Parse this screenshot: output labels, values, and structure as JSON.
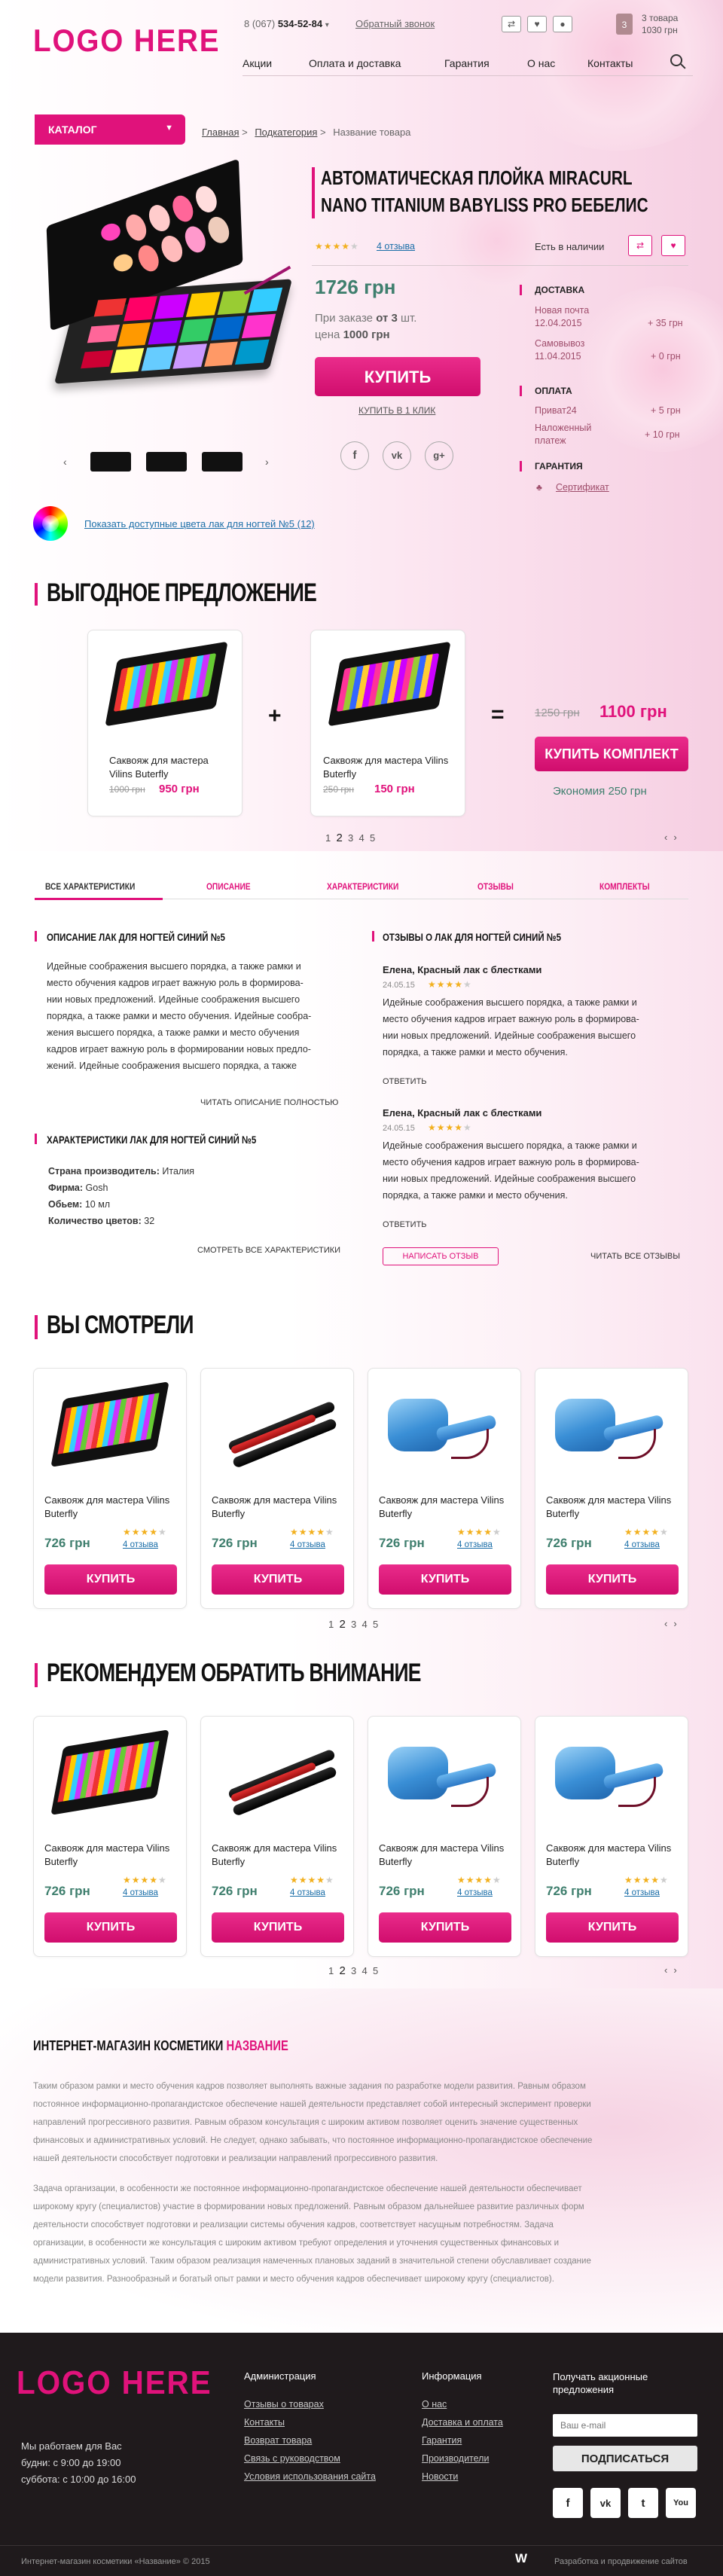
{
  "header": {
    "logo": "LOGO HERE",
    "phone_prefix": "8 (067)",
    "phone_number": "534-52-84",
    "callback": "Обратный звонок",
    "cart_count": "3",
    "cart_items": "3 товара",
    "cart_total": "1030 грн",
    "nav": [
      "Акции",
      "Оплата и доставка",
      "Гарантия",
      "О нас",
      "Контакты"
    ]
  },
  "catalog_label": "КАТАЛОГ",
  "breadcrumbs": [
    "Главная",
    "Подкатегория",
    "Название товара"
  ],
  "product": {
    "title_line1": "АВТОМАТИЧЕСКАЯ ПЛОЙКА MIRACURL",
    "title_line2": "NANO TITANIUM BABYLISS PRO БЕБЕЛИС",
    "rating": 4,
    "reviews_link": "4 отзыва",
    "stock": "Есть в наличии",
    "price": "1726 грн",
    "bulk_line1_a": "При заказе",
    "bulk_line1_b": "от 3",
    "bulk_line1_c": "шт.",
    "bulk_line2_a": "цена",
    "bulk_line2_b": "1000 грн",
    "buy": "КУПИТЬ",
    "one_click": "КУПИТЬ В 1 КЛИК",
    "colors_link": "Показать доступные цвета лак для ногтей №5 (12)"
  },
  "delivery": {
    "title": "ДОСТАВКА",
    "rows": [
      {
        "name": "Новая почта",
        "date": "12.04.2015",
        "price": "+ 35 грн"
      },
      {
        "name": "Самовывоз",
        "date": "11.04.2015",
        "price": "+ 0 грн"
      }
    ]
  },
  "payment": {
    "title": "ОПЛАТА",
    "rows": [
      {
        "name": "Приват24",
        "price": "+ 5 грн"
      },
      {
        "name": "Наложенный платеж",
        "price": "+ 10 грн"
      }
    ]
  },
  "guarantee": {
    "title": "ГАРАНТИЯ",
    "link": "Сертификат"
  },
  "bundle": {
    "title": "ВЫГОДНОЕ ПРЕДЛОЖЕНИЕ",
    "items": [
      {
        "name": "Саквояж для мастера Vilins Buterfly",
        "old": "1000 грн",
        "price": "950 грн"
      },
      {
        "name": "Саквояж для мастера Vilins Buterfly",
        "old": "250 грн",
        "price": "150 грн"
      }
    ],
    "plus": "+",
    "equals": "=",
    "old_total": "1250 грн",
    "total": "1100 грн",
    "buy": "КУПИТЬ КОМПЛЕКТ",
    "saving": "Экономия 250 грн",
    "pages": [
      "1",
      "2",
      "3",
      "4",
      "5"
    ]
  },
  "tabs": [
    "ВСЕ ХАРАКТЕРИСТИКИ",
    "ОПИСАНИЕ",
    "ХАРАКТЕРИСТИКИ",
    "ОТЗЫВЫ",
    "КОМПЛЕКТЫ"
  ],
  "description": {
    "title": "ОПИСАНИЕ ЛАК ДЛЯ НОГТЕЙ СИНИЙ №5",
    "lines": [
      "Идейные соображения высшего порядка, а также рамки и",
      "место обучения кадров играет важную роль в формирова-",
      "нии новых предложений. Идейные соображения высшего",
      "порядка, а также рамки и место обучения. Идейные сообра-",
      "жения высшего порядка, а также рамки и место обучения",
      "кадров играет важную роль в формировании новых предло-",
      "жений. Идейные соображения высшего порядка, а также"
    ],
    "more": "ЧИТАТЬ ОПИСАНИЕ ПОЛНОСТЬЮ"
  },
  "specs": {
    "title": "ХАРАКТЕРИСТИКИ ЛАК ДЛЯ НОГТЕЙ СИНИЙ №5",
    "rows": [
      {
        "k": "Страна производитель:",
        "v": "Италия"
      },
      {
        "k": "Фирма:",
        "v": "Gosh"
      },
      {
        "k": "Обьем:",
        "v": "10 мл"
      },
      {
        "k": "Количество цветов:",
        "v": "32"
      }
    ],
    "more": "СМОТРЕТЬ ВСЕ ХАРАКТЕРИСТИКИ"
  },
  "reviews": {
    "title": "ОТЗЫВЫ О ЛАК ДЛЯ НОГТЕЙ СИНИЙ №5",
    "items": [
      {
        "author": "Елена, Красный лак с блестками",
        "date": "24.05.15",
        "rating": 4,
        "lines": [
          "Идейные соображения высшего порядка, а также рамки и",
          "место обучения кадров играет важную роль в формирова-",
          "нии новых предложений. Идейные соображения высшего",
          "порядка, а также рамки и место обучения."
        ],
        "reply": "ОТВЕТИТЬ"
      },
      {
        "author": "Елена, Красный лак с блестками",
        "date": "24.05.15",
        "rating": 4,
        "lines": [
          "Идейные соображения высшего порядка, а также рамки и",
          "место обучения кадров играет важную роль в формирова-",
          "нии новых предложений. Идейные соображения высшего",
          "порядка, а также рамки и место обучения."
        ],
        "reply": "ОТВЕТИТЬ"
      }
    ],
    "write": "НАПИСАТЬ ОТЗЫВ",
    "read_all": "ЧИТАТЬ ВСЕ ОТЗЫВЫ"
  },
  "viewed": {
    "title": "ВЫ СМОТРЕЛИ",
    "products": [
      {
        "name": "Саквояж для мастера Vilins Buterfly",
        "price": "726 грн",
        "reviews": "4 отзыва",
        "rating": 4,
        "buy": "КУПИТЬ",
        "image": "palette"
      },
      {
        "name": "Саквояж для мастера Vilins Buterfly",
        "price": "726 грн",
        "reviews": "4 отзыва",
        "rating": 4,
        "buy": "КУПИТЬ",
        "image": "straightener"
      },
      {
        "name": "Саквояж для мастера Vilins Buterfly",
        "price": "726 грн",
        "reviews": "4 отзыва",
        "rating": 4,
        "buy": "КУПИТЬ",
        "image": "curler"
      },
      {
        "name": "Саквояж для мастера Vilins Buterfly",
        "price": "726 грн",
        "reviews": "4 отзыва",
        "rating": 4,
        "buy": "КУПИТЬ",
        "image": "curler"
      }
    ],
    "pages": [
      "1",
      "2",
      "3",
      "4",
      "5"
    ]
  },
  "recommended": {
    "title": "РЕКОМЕНДУЕМ ОБРАТИТЬ ВНИМАНИЕ",
    "products": [
      {
        "name": "Саквояж для мастера Vilins Buterfly",
        "price": "726 грн",
        "reviews": "4 отзыва",
        "rating": 4,
        "buy": "КУПИТЬ",
        "image": "palette"
      },
      {
        "name": "Саквояж для мастера Vilins Buterfly",
        "price": "726 грн",
        "reviews": "4 отзыва",
        "rating": 4,
        "buy": "КУПИТЬ",
        "image": "straightener"
      },
      {
        "name": "Саквояж для мастера Vilins Buterfly",
        "price": "726 грн",
        "reviews": "4 отзыва",
        "rating": 4,
        "buy": "КУПИТЬ",
        "image": "curler"
      },
      {
        "name": "Саквояж для мастера Vilins Buterfly",
        "price": "726 грн",
        "reviews": "4 отзыва",
        "rating": 4,
        "buy": "КУПИТЬ",
        "image": "curler"
      }
    ],
    "pages": [
      "1",
      "2",
      "3",
      "4",
      "5"
    ]
  },
  "seo": {
    "title_a": "ИНТЕРНЕТ-МАГАЗИН КОСМЕТИКИ",
    "title_b": "НАЗВАНИЕ",
    "p1": [
      "Таким образом рамки и место обучения кадров позволяет выполнять важные задания по разработке модели развития. Равным образом",
      "постоянное информационно-пропагандистское обеспечение нашей деятельности представляет собой интересный эксперимент проверки",
      "направлений прогрессивного развития. Равным образом консультация с широким активом позволяет оценить значение существенных",
      "финансовых и административных условий. Не следует, однако забывать, что постоянное информационно-пропагандистское обеспечение",
      "нашей деятельности способствует подготовки и реализации направлений прогрессивного развития."
    ],
    "p2": [
      "Задача организации, в особенности же постоянное информационно-пропагандистское обеспечение нашей деятельности обеспечивает",
      "широкому кругу (специалистов) участие в формировании новых предложений. Равным образом дальнейшее развитие различных форм",
      "деятельности способствует подготовки и реализации системы обучения кадров, соответствует насущным потребностям. Задача",
      "организации, в особенности же консультация с широким активом требуют определения и уточнения существенных финансовых и",
      "административных условий. Таким образом реализация намеченных плановых заданий в значительной степени обуславливает создание",
      "модели развития. Разнообразный и богатый опыт рамки и место обучения кадров обеспечивает широкому кругу (специалистов)."
    ]
  },
  "footer": {
    "logo": "LOGO HERE",
    "hours_title": "Мы работаем для Вас",
    "hours_weekdays": "будни: с 9:00 до 19:00",
    "hours_sat": "суббота: с 10:00 до 16:00",
    "admin_title": "Администрация",
    "admin_links": [
      "Отзывы о товарах",
      "Контакты",
      "Возврат товара",
      "Связь с руководством",
      "Условия использования сайта"
    ],
    "info_title": "Информация",
    "info_links": [
      "О нас",
      "Доставка и оплата",
      "Гарантия",
      "Производители",
      "Новости"
    ],
    "subscribe_title": "Получать акционные предложения",
    "email_placeholder": "Ваш e-mail",
    "subscribe_btn": "ПОДПИСАТЬСЯ",
    "social": [
      "f",
      "vk",
      "t",
      "You"
    ],
    "copyright": "Интернет-магазин косметики «Название» © 2015",
    "dev": "Разработка и продвижение сайтов"
  }
}
